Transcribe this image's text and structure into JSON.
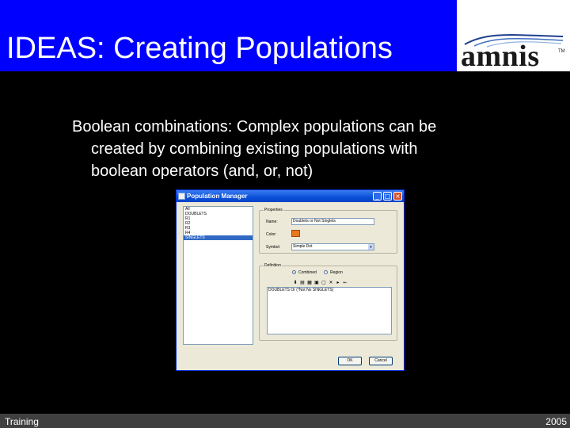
{
  "slide": {
    "title": "IDEAS: Creating Populations",
    "logo": {
      "text": "amnis",
      "tm": "TM"
    },
    "body": {
      "line1": "Boolean combinations:  Complex populations can be",
      "line2": "created by combining existing populations with",
      "line3": "boolean operators (and, or, not)"
    },
    "footer": {
      "left": "Training",
      "right": "2005"
    }
  },
  "window": {
    "title": "Population Manager",
    "populations": [
      "All",
      "DOUBLETS",
      "R1",
      "R2",
      "R3",
      "R4",
      "SINGLETS"
    ],
    "selected_index": 6,
    "properties": {
      "group_label": "Properties",
      "name_label": "Name:",
      "name_value": "Doublets or Not Singlets",
      "color_label": "Color:",
      "symbol_label": "Symbol:",
      "symbol_value": "Simple Dot"
    },
    "definition": {
      "group_label": "Definition",
      "combined_label": "Combined",
      "region_label": "Region",
      "expression": "DOUBLETS Or (*Not No SINGLETS)"
    },
    "buttons": {
      "ok": "OK",
      "cancel": "Cancel"
    }
  },
  "colors": {
    "title_bg": "#0000ff",
    "footer_bg": "#3f3f3f",
    "swatch": "#e87820"
  },
  "icons": [
    "minimize-icon",
    "maximize-icon",
    "close-icon",
    "dropdown-arrow-icon",
    "toolbar-icon"
  ]
}
